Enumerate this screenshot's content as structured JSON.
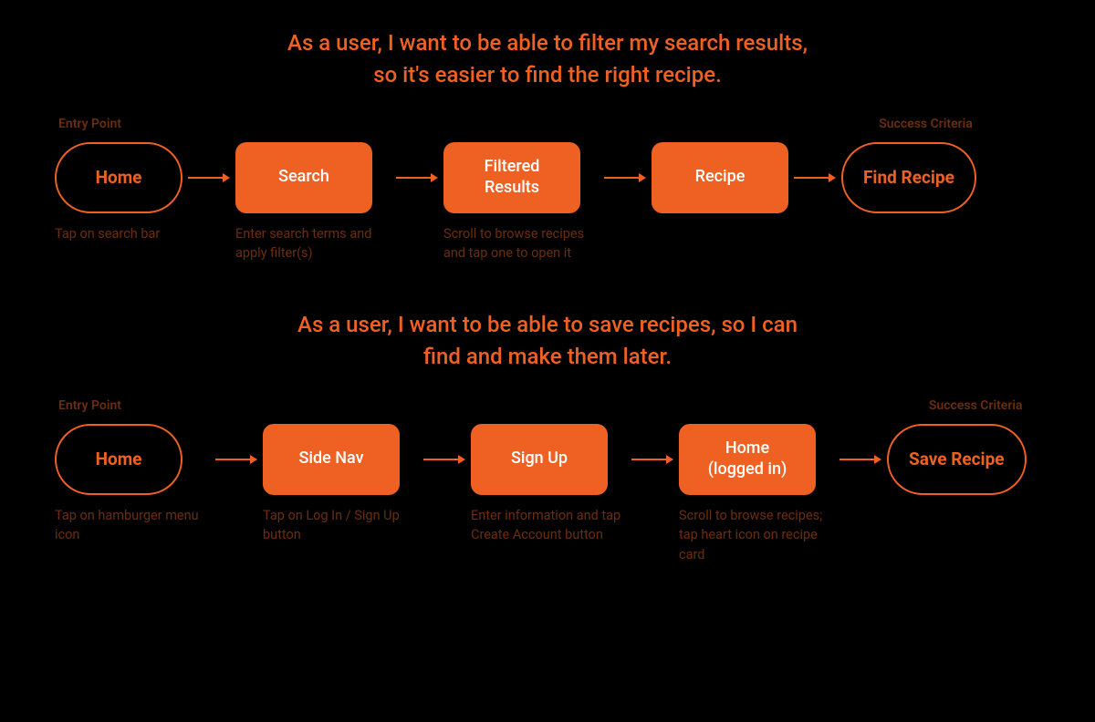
{
  "stories": [
    {
      "title": "As a user, I want to be able to filter my search results,\nso it's easier to find the right recipe.",
      "entry_label": "Entry Point",
      "success_label": "Success Criteria",
      "nodes": [
        {
          "type": "pill",
          "label": "Home",
          "desc": "Tap on search bar"
        },
        {
          "type": "box",
          "label": "Search",
          "desc": "Enter search terms and apply filter(s)"
        },
        {
          "type": "box",
          "label": "Filtered\nResults",
          "desc": "Scroll to browse recipes and tap one to open it"
        },
        {
          "type": "box",
          "label": "Recipe",
          "desc": ""
        },
        {
          "type": "pill",
          "label": "Find Recipe",
          "desc": ""
        }
      ]
    },
    {
      "title": "As a user, I want to be able to save recipes, so I can\nfind and make them later.",
      "entry_label": "Entry Point",
      "success_label": "Success Criteria",
      "nodes": [
        {
          "type": "pill",
          "label": "Home",
          "desc": "Tap on hamburger menu icon"
        },
        {
          "type": "box",
          "label": "Side Nav",
          "desc": "Tap on Log In / Sign Up button"
        },
        {
          "type": "box",
          "label": "Sign Up",
          "desc": "Enter information and tap Create Account button"
        },
        {
          "type": "box",
          "label": "Home\n(logged in)",
          "desc": "Scroll to browse recipes; tap heart icon on recipe card"
        },
        {
          "type": "pill",
          "label": "Save Recipe",
          "desc": ""
        }
      ]
    }
  ],
  "colors": {
    "accent": "#ee6123",
    "text_muted": "#6a2e0f",
    "bg": "#000000"
  }
}
